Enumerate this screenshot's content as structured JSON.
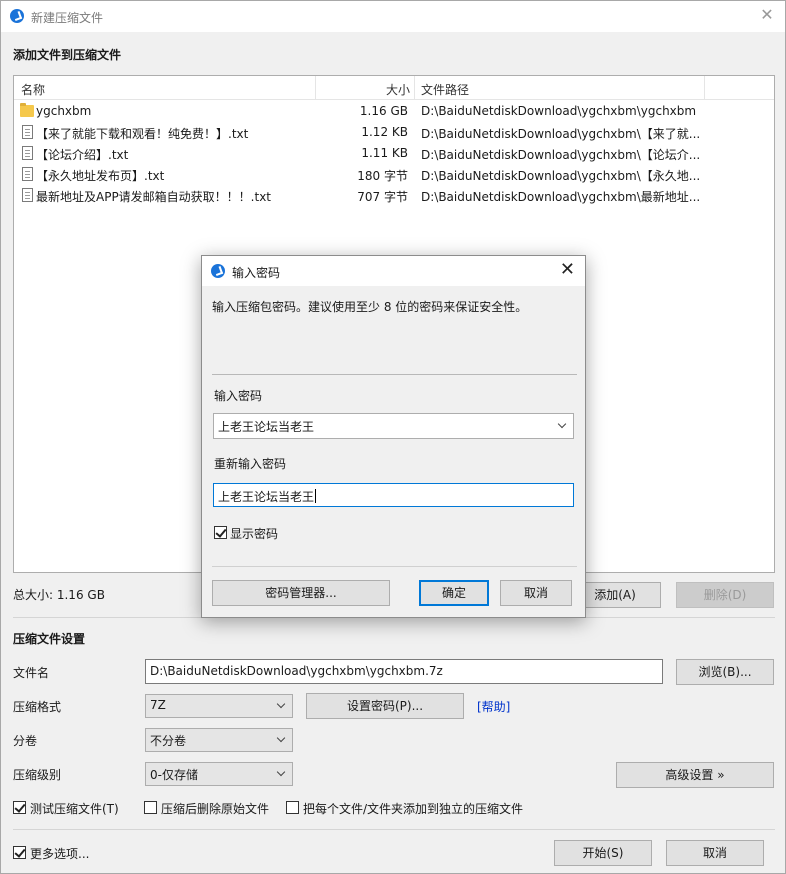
{
  "window": {
    "title": "新建压缩文件"
  },
  "files_section": {
    "title": "添加文件到压缩文件",
    "columns": {
      "name": "名称",
      "size": "大小",
      "path": "文件路径"
    },
    "rows": [
      {
        "type": "folder",
        "name": "ygchxbm",
        "size": "1.16 GB",
        "path": "D:\\BaiduNetdiskDownload\\ygchxbm\\ygchxbm"
      },
      {
        "type": "file",
        "name": "【来了就能下载和观看！纯免费！】.txt",
        "size": "1.12 KB",
        "path": "D:\\BaiduNetdiskDownload\\ygchxbm\\【来了就..."
      },
      {
        "type": "file",
        "name": "【论坛介绍】.txt",
        "size": "1.11 KB",
        "path": "D:\\BaiduNetdiskDownload\\ygchxbm\\【论坛介..."
      },
      {
        "type": "file",
        "name": "【永久地址发布页】.txt",
        "size": "180 字节",
        "path": "D:\\BaiduNetdiskDownload\\ygchxbm\\【永久地..."
      },
      {
        "type": "file",
        "name": "最新地址及APP请发邮箱自动获取！！！.txt",
        "size": "707 字节",
        "path": "D:\\BaiduNetdiskDownload\\ygchxbm\\最新地址..."
      }
    ],
    "total_size": "总大小: 1.16 GB",
    "add_button": "添加(A)",
    "delete_button": "删除(D)"
  },
  "settings": {
    "title": "压缩文件设置",
    "filename_label": "文件名",
    "filename_value": "D:\\BaiduNetdiskDownload\\ygchxbm\\ygchxbm.7z",
    "browse_button": "浏览(B)...",
    "format_label": "压缩格式",
    "format_value": "7Z",
    "set_password_button": "设置密码(P)...",
    "help_link": "[帮助]",
    "split_label": "分卷",
    "split_value": "不分卷",
    "level_label": "压缩级别",
    "level_value": "0-仅存储",
    "advanced_button": "高级设置 »",
    "test_checkbox": "测试压缩文件(T)",
    "delete_after_checkbox": "压缩后删除原始文件",
    "separate_checkbox": "把每个文件/文件夹添加到独立的压缩文件",
    "more_options_checkbox": "更多选项...",
    "start_button": "开始(S)",
    "cancel_button": "取消"
  },
  "dialog": {
    "title": "输入密码",
    "description": "输入压缩包密码。建议使用至少 8 位的密码来保证安全性。",
    "password_label": "输入密码",
    "password_value": "上老王论坛当老王",
    "confirm_label": "重新输入密码",
    "confirm_value": "上老王论坛当老王",
    "show_password": "显示密码",
    "manager_button": "密码管理器...",
    "ok_button": "确定",
    "cancel_button": "取消"
  }
}
